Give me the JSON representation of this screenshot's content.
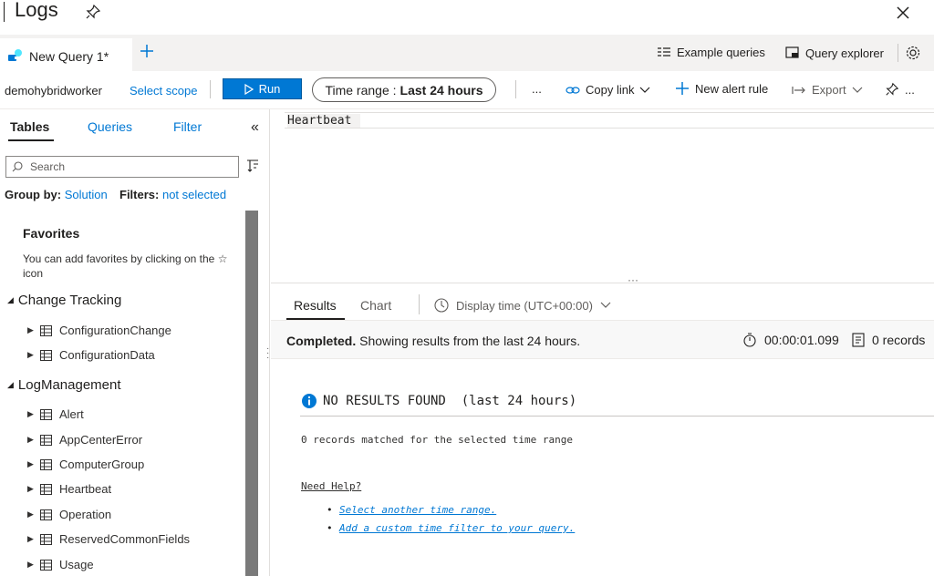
{
  "window": {
    "title": "Logs"
  },
  "tabs": [
    {
      "label": "New Query 1*"
    }
  ],
  "toolbar_top": {
    "example_queries": "Example queries",
    "query_explorer": "Query explorer"
  },
  "command_bar": {
    "scope": "demohybridworker",
    "select_scope": "Select scope",
    "run": "Run",
    "time_range_label": "Time range :",
    "time_range_value": "Last 24 hours",
    "more": "...",
    "copy_link": "Copy link",
    "new_alert_rule": "New alert rule",
    "export": "Export",
    "pin_more": "..."
  },
  "left_panel": {
    "tabs": [
      "Tables",
      "Queries",
      "Filter"
    ],
    "search_placeholder": "Search",
    "group_by_label": "Group by:",
    "group_by_value": "Solution",
    "filters_label": "Filters:",
    "filters_value": "not selected",
    "favorites_title": "Favorites",
    "favorites_desc": "You can add favorites by clicking on the ☆ icon",
    "groups": [
      {
        "name": "Change Tracking",
        "tables": [
          "ConfigurationChange",
          "ConfigurationData"
        ]
      },
      {
        "name": "LogManagement",
        "tables": [
          "Alert",
          "AppCenterError",
          "ComputerGroup",
          "Heartbeat",
          "Operation",
          "ReservedCommonFields",
          "Usage"
        ]
      }
    ]
  },
  "editor": {
    "query": "Heartbeat"
  },
  "results": {
    "tabs": [
      "Results",
      "Chart"
    ],
    "display_time": "Display time (UTC+00:00)",
    "status_bold": "Completed.",
    "status_rest": " Showing results from the last 24 hours.",
    "duration": "00:00:01.099",
    "records": "0 records",
    "no_results": "NO RESULTS FOUND  (last 24 hours)",
    "matched": "0 records matched for the selected time range",
    "need_help": "Need Help?",
    "help_links": [
      "Select another time range.",
      "Add a custom time filter to your query."
    ]
  },
  "colors": {
    "accent": "#0078d4",
    "scrollbar": "#7a7a7a"
  }
}
